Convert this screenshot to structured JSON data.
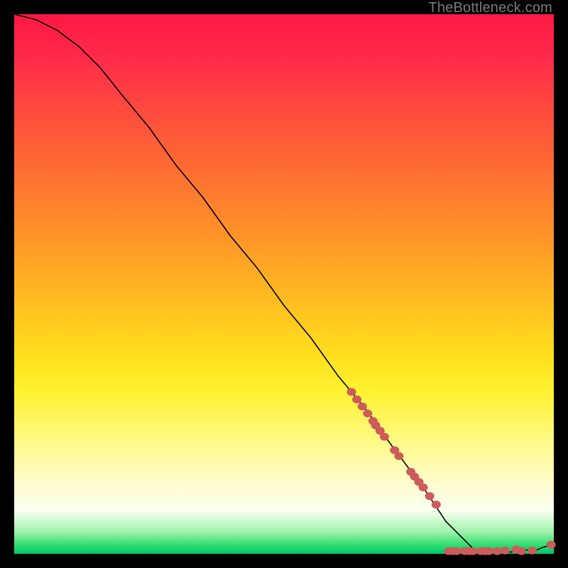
{
  "attribution": "TheBottleneck.com",
  "chart_data": {
    "type": "line",
    "title": "",
    "xlabel": "",
    "ylabel": "",
    "xlim": [
      0,
      100
    ],
    "ylim": [
      0,
      100
    ],
    "grid": false,
    "legend": false,
    "series": [
      {
        "name": "bottleneck-curve",
        "x": [
          0,
          4,
          8,
          12,
          16,
          20,
          25,
          30,
          35,
          40,
          45,
          50,
          55,
          60,
          65,
          70,
          73,
          76,
          78,
          80,
          82,
          84,
          85,
          86,
          88,
          90,
          92,
          94,
          96,
          98,
          100
        ],
        "y": [
          100,
          99,
          97,
          94,
          90,
          85,
          79,
          72,
          66,
          59,
          53,
          46,
          40,
          33,
          27,
          20,
          16,
          12,
          9,
          6,
          4,
          2,
          1,
          0.5,
          0.3,
          0.4,
          0.3,
          1.0,
          0.4,
          1.2,
          1.8
        ]
      }
    ],
    "markers": {
      "name": "highlight-points",
      "x": [
        62.5,
        63.5,
        64.5,
        65.5,
        66.5,
        67.0,
        67.8,
        68.6,
        70.5,
        71.3,
        73.5,
        74.2,
        75.0,
        75.8,
        77.0,
        78.2,
        80.5,
        81.3,
        82.0,
        83.5,
        84.3,
        85.0,
        86.5,
        87.3,
        88.0,
        89.5,
        91.0,
        93.0,
        94.0,
        96.0,
        99.5
      ],
      "y": [
        30.0,
        28.6,
        27.3,
        26.0,
        24.6,
        23.8,
        22.8,
        21.7,
        19.2,
        18.1,
        15.2,
        14.3,
        13.3,
        12.3,
        10.7,
        9.1,
        0.5,
        0.5,
        0.5,
        0.5,
        0.5,
        0.5,
        0.5,
        0.5,
        0.5,
        0.5,
        0.6,
        0.8,
        0.5,
        0.6,
        1.7
      ]
    }
  }
}
